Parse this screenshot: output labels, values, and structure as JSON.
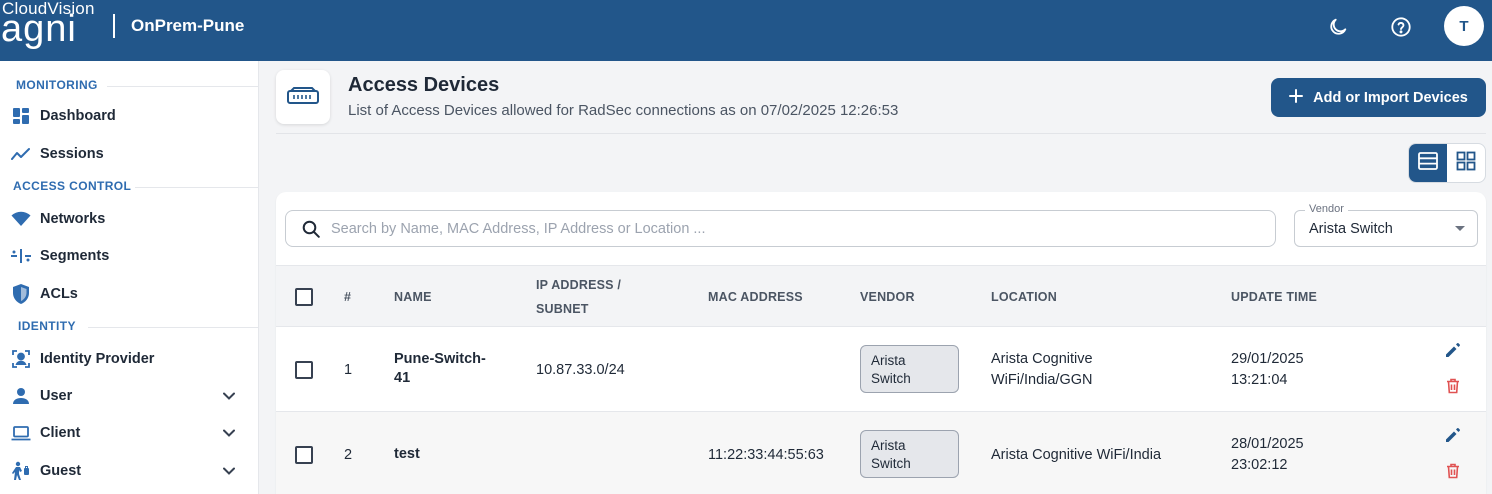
{
  "topbar": {
    "brand_small": "CloudVision",
    "brand_big": "agni",
    "tenant": "OnPrem-Pune",
    "icons": [
      "moon-icon",
      "help-icon"
    ],
    "avatar_initial": "T"
  },
  "sidebar": {
    "monitoring_label": "MONITORING",
    "access_control_label": "ACCESS CONTROL",
    "identity_label": "IDENTITY",
    "items": [
      {
        "label": "Dashboard",
        "icon": "dashboard-icon"
      },
      {
        "label": "Sessions",
        "icon": "trend-icon"
      },
      {
        "label": "Networks",
        "icon": "wifi-icon"
      },
      {
        "label": "Segments",
        "icon": "segments-icon"
      },
      {
        "label": "ACLs",
        "icon": "shield-icon"
      },
      {
        "label": "Identity Provider",
        "icon": "identity-provider-icon"
      },
      {
        "label": "User",
        "icon": "user-icon"
      },
      {
        "label": "Client",
        "icon": "laptop-icon"
      },
      {
        "label": "Guest",
        "icon": "guest-icon"
      }
    ]
  },
  "header": {
    "title": "Access Devices",
    "subtitle": "List of Access Devices allowed for RadSec connections as on 07/02/2025 12:26:53",
    "add_button": "Add or Import Devices"
  },
  "filters": {
    "search_placeholder": "Search by Name, MAC Address, IP Address or Location ...",
    "vendor_label": "Vendor",
    "vendor_value": "Arista Switch"
  },
  "table": {
    "columns": {
      "num": "#",
      "name": "NAME",
      "ip_line1": "IP ADDRESS /",
      "ip_line2": "SUBNET",
      "mac": "MAC ADDRESS",
      "vendor": "VENDOR",
      "location": "LOCATION",
      "update_time": "UPDATE TIME"
    },
    "rows": [
      {
        "num": "1",
        "name_line1": "Pune-Switch-",
        "name_line2": "41",
        "ip": "10.87.33.0/24",
        "mac": "",
        "vendor_line1": "Arista",
        "vendor_line2": "Switch",
        "location_line1": "Arista Cognitive",
        "location_line2": "WiFi/India/GGN",
        "date": "29/01/2025",
        "time": "13:21:04"
      },
      {
        "num": "2",
        "name_line1": "test",
        "name_line2": "",
        "ip": "",
        "mac": "11:22:33:44:55:63",
        "vendor_line1": "Arista",
        "vendor_line2": "Switch",
        "location_line1": "Arista Cognitive WiFi/India",
        "location_line2": "",
        "date": "28/01/2025",
        "time": "23:02:12"
      }
    ]
  },
  "colors": {
    "brand": "#22568a",
    "section_label": "#2f6cb0",
    "delete": "#e05252"
  }
}
